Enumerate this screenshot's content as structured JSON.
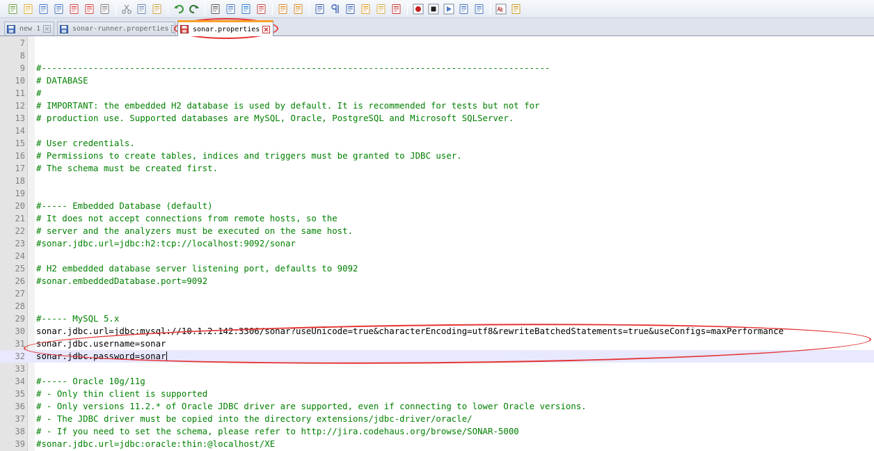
{
  "toolbar": {
    "icons": [
      "new-file-icon",
      "open-file-icon",
      "save-icon",
      "save-all-icon",
      "close-icon",
      "close-all-icon",
      "print-icon",
      "cut-icon",
      "copy-icon",
      "paste-icon",
      "undo-icon",
      "redo-icon",
      "find-icon",
      "replace-icon",
      "zoom-in-icon",
      "zoom-out-icon",
      "sync-vertical-icon",
      "sync-horizontal-icon",
      "word-wrap-icon",
      "show-all-chars-icon",
      "indent-guide-icon",
      "user-language-icon",
      "document-map-icon",
      "function-list-icon",
      "record-macro-icon",
      "stop-macro-icon",
      "play-macro-icon",
      "run-macro-multiple-icon",
      "save-macro-icon",
      "spell-check-icon",
      "extra-icon"
    ]
  },
  "tabs": [
    {
      "label": "new  1",
      "active": false
    },
    {
      "label": "sonar-runner.properties",
      "active": false
    },
    {
      "label": "sonar.properties",
      "active": true
    }
  ],
  "editor": {
    "current_line": 32,
    "lines": [
      {
        "num": "7",
        "text": "",
        "kind": "code"
      },
      {
        "num": "8",
        "text": "",
        "kind": "code"
      },
      {
        "num": "9",
        "text": "#--------------------------------------------------------------------------------------------------",
        "kind": "comment"
      },
      {
        "num": "10",
        "text": "# DATABASE",
        "kind": "comment"
      },
      {
        "num": "11",
        "text": "#",
        "kind": "comment"
      },
      {
        "num": "12",
        "text": "# IMPORTANT: the embedded H2 database is used by default. It is recommended for tests but not for",
        "kind": "comment"
      },
      {
        "num": "13",
        "text": "# production use. Supported databases are MySQL, Oracle, PostgreSQL and Microsoft SQLServer.",
        "kind": "comment"
      },
      {
        "num": "14",
        "text": "",
        "kind": "code"
      },
      {
        "num": "15",
        "text": "# User credentials.",
        "kind": "comment"
      },
      {
        "num": "16",
        "text": "# Permissions to create tables, indices and triggers must be granted to JDBC user.",
        "kind": "comment"
      },
      {
        "num": "17",
        "text": "# The schema must be created first.",
        "kind": "comment"
      },
      {
        "num": "18",
        "text": "",
        "kind": "code"
      },
      {
        "num": "19",
        "text": "",
        "kind": "code"
      },
      {
        "num": "20",
        "text": "#----- Embedded Database (default)",
        "kind": "comment"
      },
      {
        "num": "21",
        "text": "# It does not accept connections from remote hosts, so the",
        "kind": "comment"
      },
      {
        "num": "22",
        "text": "# server and the analyzers must be executed on the same host.",
        "kind": "comment"
      },
      {
        "num": "23",
        "text": "#sonar.jdbc.url=jdbc:h2:tcp://localhost:9092/sonar",
        "kind": "comment"
      },
      {
        "num": "24",
        "text": "",
        "kind": "code"
      },
      {
        "num": "25",
        "text": "# H2 embedded database server listening port, defaults to 9092",
        "kind": "comment"
      },
      {
        "num": "26",
        "text": "#sonar.embeddedDatabase.port=9092",
        "kind": "comment"
      },
      {
        "num": "27",
        "text": "",
        "kind": "code"
      },
      {
        "num": "28",
        "text": "",
        "kind": "code"
      },
      {
        "num": "29",
        "text": "#----- MySQL 5.x",
        "kind": "comment"
      },
      {
        "num": "30",
        "text": "sonar.jdbc.url=jdbc:mysql://10.1.2.142:3306/sonar?useUnicode=true&characterEncoding=utf8&rewriteBatchedStatements=true&useConfigs=maxPerformance",
        "kind": "code"
      },
      {
        "num": "31",
        "text": "sonar.jdbc.username=sonar",
        "kind": "code"
      },
      {
        "num": "32",
        "text": "sonar.jdbc.password=sonar",
        "kind": "code"
      },
      {
        "num": "33",
        "text": "",
        "kind": "code"
      },
      {
        "num": "34",
        "text": "#----- Oracle 10g/11g",
        "kind": "comment"
      },
      {
        "num": "35",
        "text": "# - Only thin client is supported",
        "kind": "comment"
      },
      {
        "num": "36",
        "text": "# - Only versions 11.2.* of Oracle JDBC driver are supported, even if connecting to lower Oracle versions.",
        "kind": "comment"
      },
      {
        "num": "37",
        "text": "# - The JDBC driver must be copied into the directory extensions/jdbc-driver/oracle/",
        "kind": "comment"
      },
      {
        "num": "38",
        "text": "# - If you need to set the schema, please refer to http://jira.codehaus.org/browse/SONAR-5000",
        "kind": "comment"
      },
      {
        "num": "39",
        "text": "#sonar.jdbc.url=jdbc:oracle:thin:@localhost/XE",
        "kind": "comment"
      }
    ]
  },
  "colors": {
    "comment": "#008000",
    "code": "#000000",
    "current_line_bg": "#e8e8ff",
    "active_tab_accent": "#fa9f2b",
    "annotation": "#e53333"
  }
}
